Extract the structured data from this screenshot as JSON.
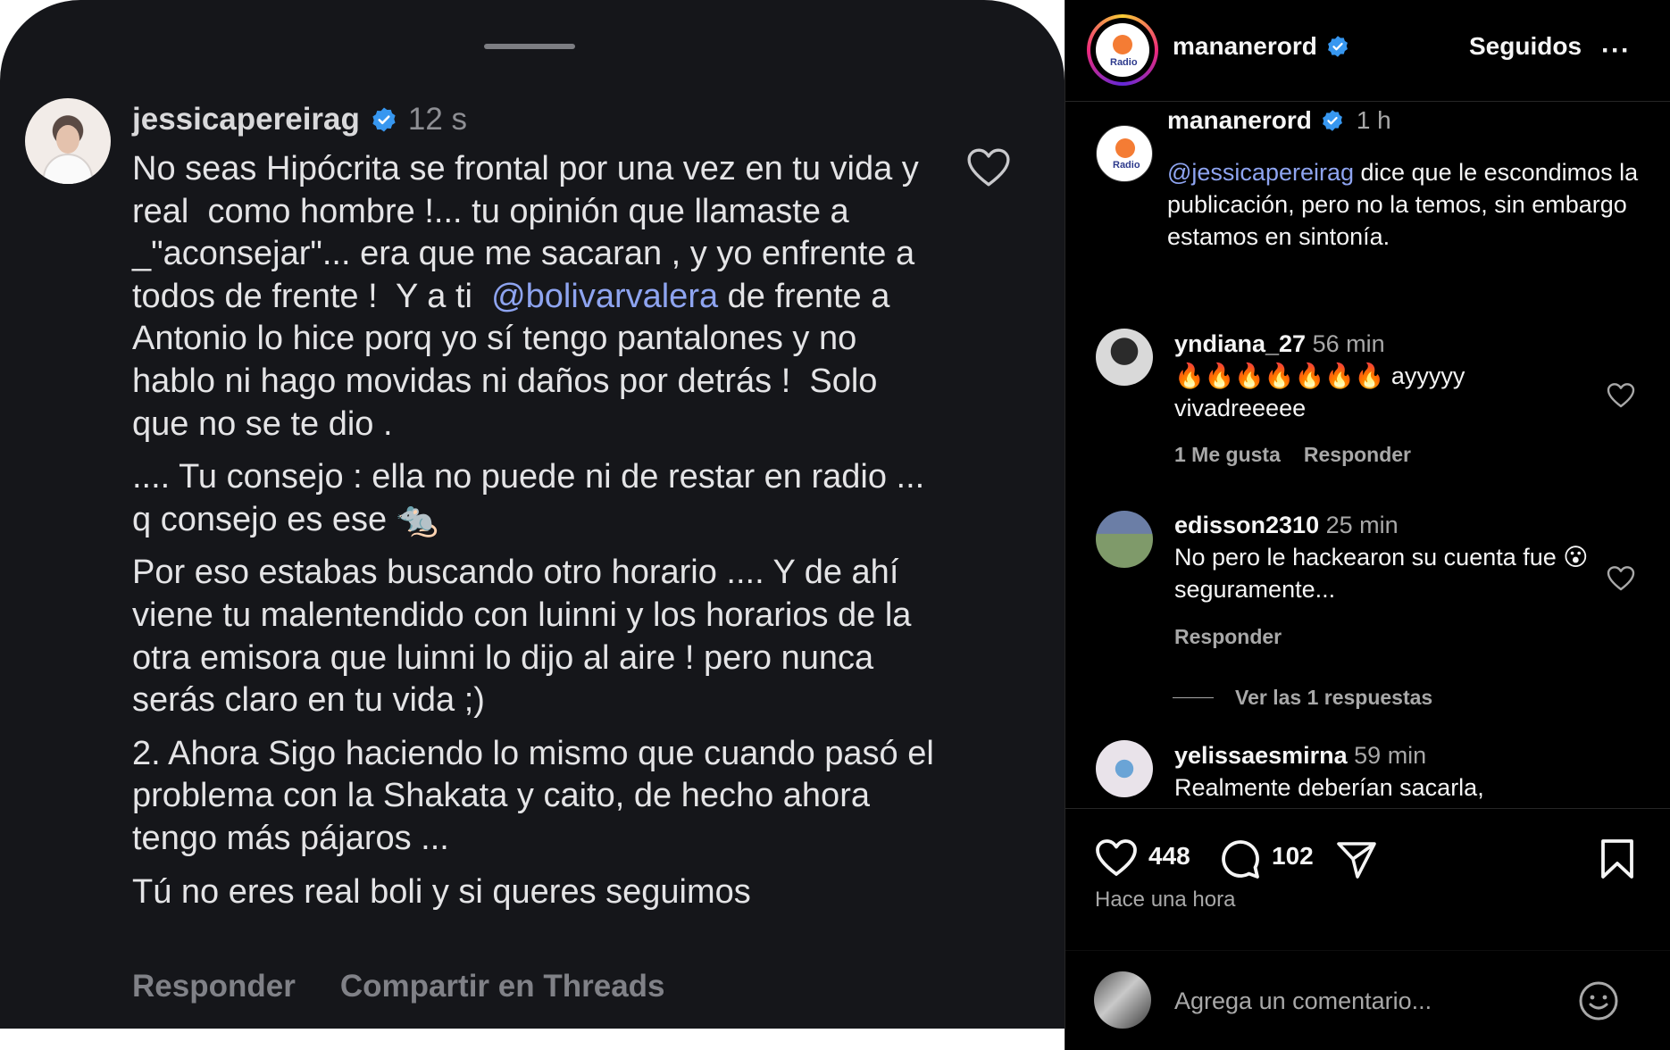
{
  "story_comment": {
    "username": "jessicapereirag",
    "time": "12 s",
    "paragraphs": [
      {
        "parts": [
          {
            "text": "No seas Hipócrita se frontal por una vez en tu vida y real  como hombre !... tu opinión que llamaste a  _\"aconsejar\"... era que me sacaran , y yo enfrente a todos de frente !  Y a ti  ",
            "mention": false
          },
          {
            "text": "@bolivarvalera",
            "mention": true
          },
          {
            "text": " de frente a Antonio lo hice porq yo sí tengo pantalones y no hablo ni hago movidas ni daños por detrás !  Solo que no se te dio .",
            "mention": false
          }
        ]
      },
      {
        "parts": [
          {
            "text": ".... Tu consejo : ella no puede ni de restar en radio ... q consejo es ese 🐀",
            "mention": false
          }
        ]
      },
      {
        "parts": [
          {
            "text": "Por eso estabas buscando otro horario .... Y de ahí viene tu malentendido con luinni y los horarios de la otra emisora que luinni lo dijo al aire ! pero nunca serás claro en tu vida ;)",
            "mention": false
          }
        ]
      },
      {
        "parts": [
          {
            "text": "2. Ahora Sigo haciendo lo mismo que cuando pasó el problema con la Shakata y caito, de hecho ahora tengo más pájaros ...",
            "mention": false
          }
        ]
      },
      {
        "parts": [
          {
            "text": "Tú no eres real boli y si queres seguimos",
            "mention": false
          }
        ]
      }
    ],
    "actions": {
      "reply": "Responder",
      "share": "Compartir en Threads"
    }
  },
  "post": {
    "header": {
      "username": "mananerord",
      "follow_label": "Seguidos",
      "more_label": "···",
      "logo_text": "Radio"
    },
    "caption": {
      "username": "mananerord",
      "time": "1 h",
      "mention": "@jessicapereirag",
      "text": " dice que le escondimos la publicación, pero no la temos, sin embargo estamos en sintonía."
    },
    "comments": [
      {
        "username": "yndiana_27",
        "time": "56 min",
        "text": "🔥🔥🔥🔥🔥🔥🔥 ayyyyy vivadreeeee",
        "likes": "1 Me gusta",
        "reply": "Responder"
      },
      {
        "username": "edisson2310",
        "time": "25 min",
        "text": "No pero le hackearon su cuenta fue 😮 seguramente...",
        "reply": "Responder",
        "view_replies": "Ver las 1 respuestas"
      },
      {
        "username": "yelissaesmirna",
        "time": "59 min",
        "text": "Realmente deberían sacarla,"
      }
    ],
    "likes_count": "448",
    "comments_count": "102",
    "time_ago": "Hace una hora",
    "add_comment_placeholder": "Agrega un comentario..."
  },
  "colors": {
    "mention": "#8ea4f0",
    "verified": "#3797f0",
    "bg_dark": "#15161a",
    "bg_ig": "#000000"
  }
}
